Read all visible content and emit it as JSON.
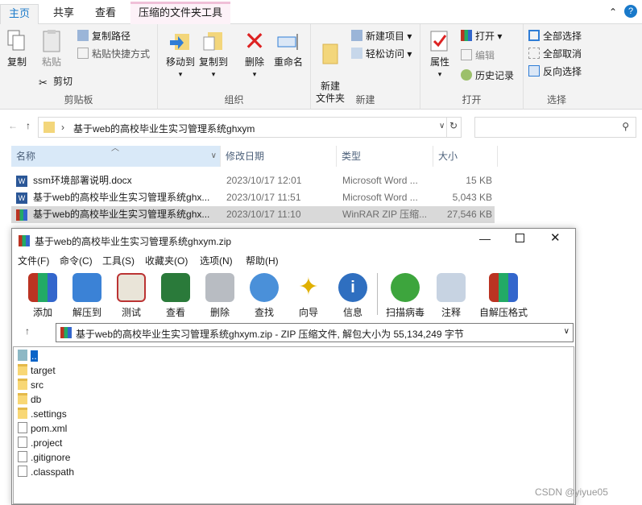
{
  "ribbon_tabs": [
    "主页",
    "共享",
    "查看",
    "压缩的文件夹工具"
  ],
  "clipboard": {
    "copy": "复制",
    "paste": "粘贴",
    "copy_path": "复制路径",
    "paste_shortcut": "粘贴快捷方式",
    "cut": "剪切",
    "label": "剪贴板"
  },
  "organize": {
    "move_to": "移动到",
    "copy_to": "复制到",
    "delete": "删除",
    "rename": "重命名",
    "label": "组织"
  },
  "new": {
    "new_folder": "新建\n文件夹",
    "new_item": "新建项目",
    "easy_access": "轻松访问",
    "label": "新建"
  },
  "open": {
    "properties": "属性",
    "open": "打开",
    "edit": "编辑",
    "history": "历史记录",
    "label": "打开"
  },
  "select": {
    "select_all": "全部选择",
    "select_none": "全部取消",
    "invert": "反向选择",
    "label": "选择"
  },
  "address": {
    "path": "基于web的高校毕业生实习管理系统ghxym"
  },
  "columns": {
    "name": "名称",
    "date": "修改日期",
    "type": "类型",
    "size": "大小"
  },
  "files": [
    {
      "name": "ssm环境部署说明.docx",
      "date": "2023/10/17 12:01",
      "type": "Microsoft Word ...",
      "size": "15 KB"
    },
    {
      "name": "基于web的高校毕业生实习管理系统ghx...",
      "date": "2023/10/17 11:51",
      "type": "Microsoft Word ...",
      "size": "5,043 KB"
    },
    {
      "name": "基于web的高校毕业生实习管理系统ghx...",
      "date": "2023/10/17 11:10",
      "type": "WinRAR ZIP 压缩...",
      "size": "27,546 KB"
    }
  ],
  "rar": {
    "title": "基于web的高校毕业生实习管理系统ghxym.zip",
    "menu": [
      "文件(F)",
      "命令(C)",
      "工具(S)",
      "收藏夹(O)",
      "选项(N)",
      "帮助(H)"
    ],
    "toolbar": [
      "添加",
      "解压到",
      "测试",
      "查看",
      "删除",
      "查找",
      "向导",
      "信息",
      "扫描病毒",
      "注释",
      "自解压格式"
    ],
    "path": "基于web的高校毕业生实习管理系统ghxym.zip - ZIP 压缩文件, 解包大小为 55,134,249 字节",
    "entries": [
      {
        "name": "..",
        "kind": "up"
      },
      {
        "name": "target",
        "kind": "folder"
      },
      {
        "name": "src",
        "kind": "folder"
      },
      {
        "name": "db",
        "kind": "folder"
      },
      {
        "name": ".settings",
        "kind": "folder"
      },
      {
        "name": "pom.xml",
        "kind": "file"
      },
      {
        "name": ".project",
        "kind": "file"
      },
      {
        "name": ".gitignore",
        "kind": "file"
      },
      {
        "name": ".classpath",
        "kind": "file"
      }
    ]
  },
  "watermark": "CSDN @yiyue05"
}
